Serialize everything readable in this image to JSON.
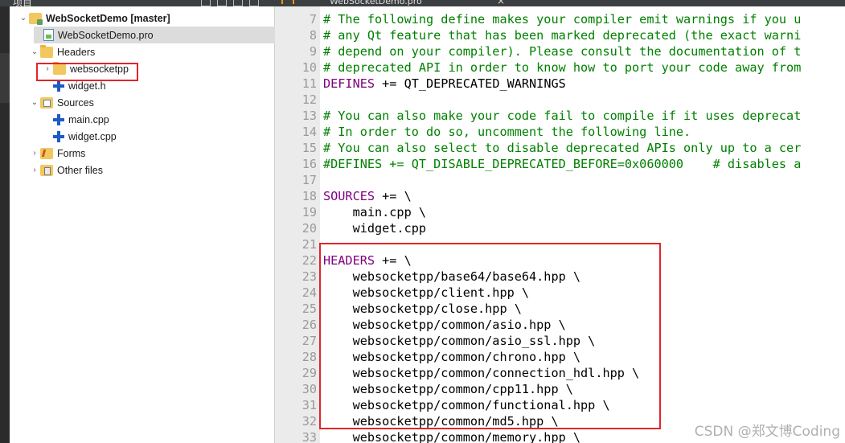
{
  "toolbar": {
    "panel_title": "项目",
    "editor_tab": "WebSocketDemo.pro",
    "close_symbol": "×"
  },
  "tree": {
    "project": "WebSocketDemo [master]",
    "pro_file": "WebSocketDemo.pro",
    "headers": "Headers",
    "websocketpp": "websocketpp",
    "widget_h": "widget.h",
    "sources": "Sources",
    "main_cpp": "main.cpp",
    "widget_cpp": "widget.cpp",
    "forms": "Forms",
    "other_files": "Other files"
  },
  "code_lines": [
    {
      "n": "7",
      "t": "# The following define makes your compiler emit warnings if you u",
      "k": "comment"
    },
    {
      "n": "8",
      "t": "# any Qt feature that has been marked deprecated (the exact warni",
      "k": "comment"
    },
    {
      "n": "9",
      "t": "# depend on your compiler). Please consult the documentation of t",
      "k": "comment"
    },
    {
      "n": "10",
      "t": "# deprecated API in order to know how to port your code away from",
      "k": "comment"
    },
    {
      "n": "11",
      "key": "DEFINES",
      "t": " += QT_DEPRECATED_WARNINGS",
      "k": "keyed"
    },
    {
      "n": "12",
      "t": "",
      "k": "text"
    },
    {
      "n": "13",
      "t": "# You can also make your code fail to compile if it uses deprecat",
      "k": "comment"
    },
    {
      "n": "14",
      "t": "# In order to do so, uncomment the following line.",
      "k": "comment"
    },
    {
      "n": "15",
      "t": "# You can also select to disable deprecated APIs only up to a cer",
      "k": "comment"
    },
    {
      "n": "16",
      "t": "#DEFINES += QT_DISABLE_DEPRECATED_BEFORE=0x060000    # disables a",
      "k": "comment"
    },
    {
      "n": "17",
      "t": "",
      "k": "text"
    },
    {
      "n": "18",
      "key": "SOURCES",
      "t": " += \\",
      "k": "keyed"
    },
    {
      "n": "19",
      "t": "    main.cpp \\",
      "k": "text"
    },
    {
      "n": "20",
      "t": "    widget.cpp",
      "k": "text"
    },
    {
      "n": "21",
      "t": "",
      "k": "text"
    },
    {
      "n": "22",
      "key": "HEADERS",
      "t": " += \\",
      "k": "keyed"
    },
    {
      "n": "23",
      "t": "    websocketpp/base64/base64.hpp \\",
      "k": "text"
    },
    {
      "n": "24",
      "t": "    websocketpp/client.hpp \\",
      "k": "text"
    },
    {
      "n": "25",
      "t": "    websocketpp/close.hpp \\",
      "k": "text"
    },
    {
      "n": "26",
      "t": "    websocketpp/common/asio.hpp \\",
      "k": "text"
    },
    {
      "n": "27",
      "t": "    websocketpp/common/asio_ssl.hpp \\",
      "k": "text"
    },
    {
      "n": "28",
      "t": "    websocketpp/common/chrono.hpp \\",
      "k": "text"
    },
    {
      "n": "29",
      "t": "    websocketpp/common/connection_hdl.hpp \\",
      "k": "text"
    },
    {
      "n": "30",
      "t": "    websocketpp/common/cpp11.hpp \\",
      "k": "text"
    },
    {
      "n": "31",
      "t": "    websocketpp/common/functional.hpp \\",
      "k": "text"
    },
    {
      "n": "32",
      "t": "    websocketpp/common/md5.hpp \\",
      "k": "text"
    },
    {
      "n": "33",
      "t": "    websocketpp/common/memory.hpp \\",
      "k": "text"
    }
  ],
  "watermark": "CSDN @郑文博Coding",
  "colors": {
    "comment": "#008000",
    "keyword": "#800080",
    "highlight_box": "#e0262b"
  }
}
